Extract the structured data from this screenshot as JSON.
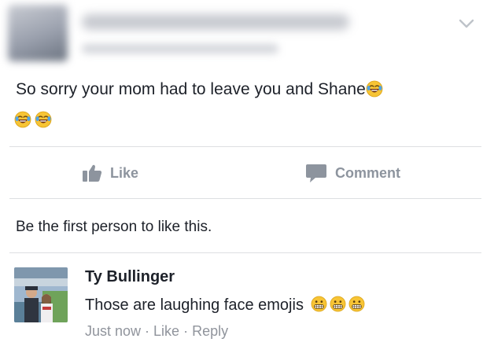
{
  "post": {
    "text": "So sorry your mom had to leave you and Shane",
    "inline_emoji": "crying-laughing-face",
    "trailing_emojis": [
      "crying-laughing-face",
      "crying-laughing-face"
    ]
  },
  "actions": {
    "like_label": "Like",
    "comment_label": "Comment"
  },
  "likes_summary": "Be the first person to like this.",
  "comment": {
    "author": "Ty Bullinger",
    "text": "Those are laughing face emojis",
    "emojis": [
      "grimacing-face",
      "grimacing-face",
      "grimacing-face"
    ],
    "timestamp": "Just now",
    "like_label": "Like",
    "reply_label": "Reply",
    "separator": "·"
  },
  "colors": {
    "text": "#1d2129",
    "muted": "#90949c",
    "action": "#8d949e",
    "divider": "#dddfe2",
    "emoji_yellow": "#f7c435"
  },
  "icons": {
    "like": "thumbs-up-icon",
    "comment": "speech-bubble-icon",
    "menu": "chevron-down-icon"
  }
}
